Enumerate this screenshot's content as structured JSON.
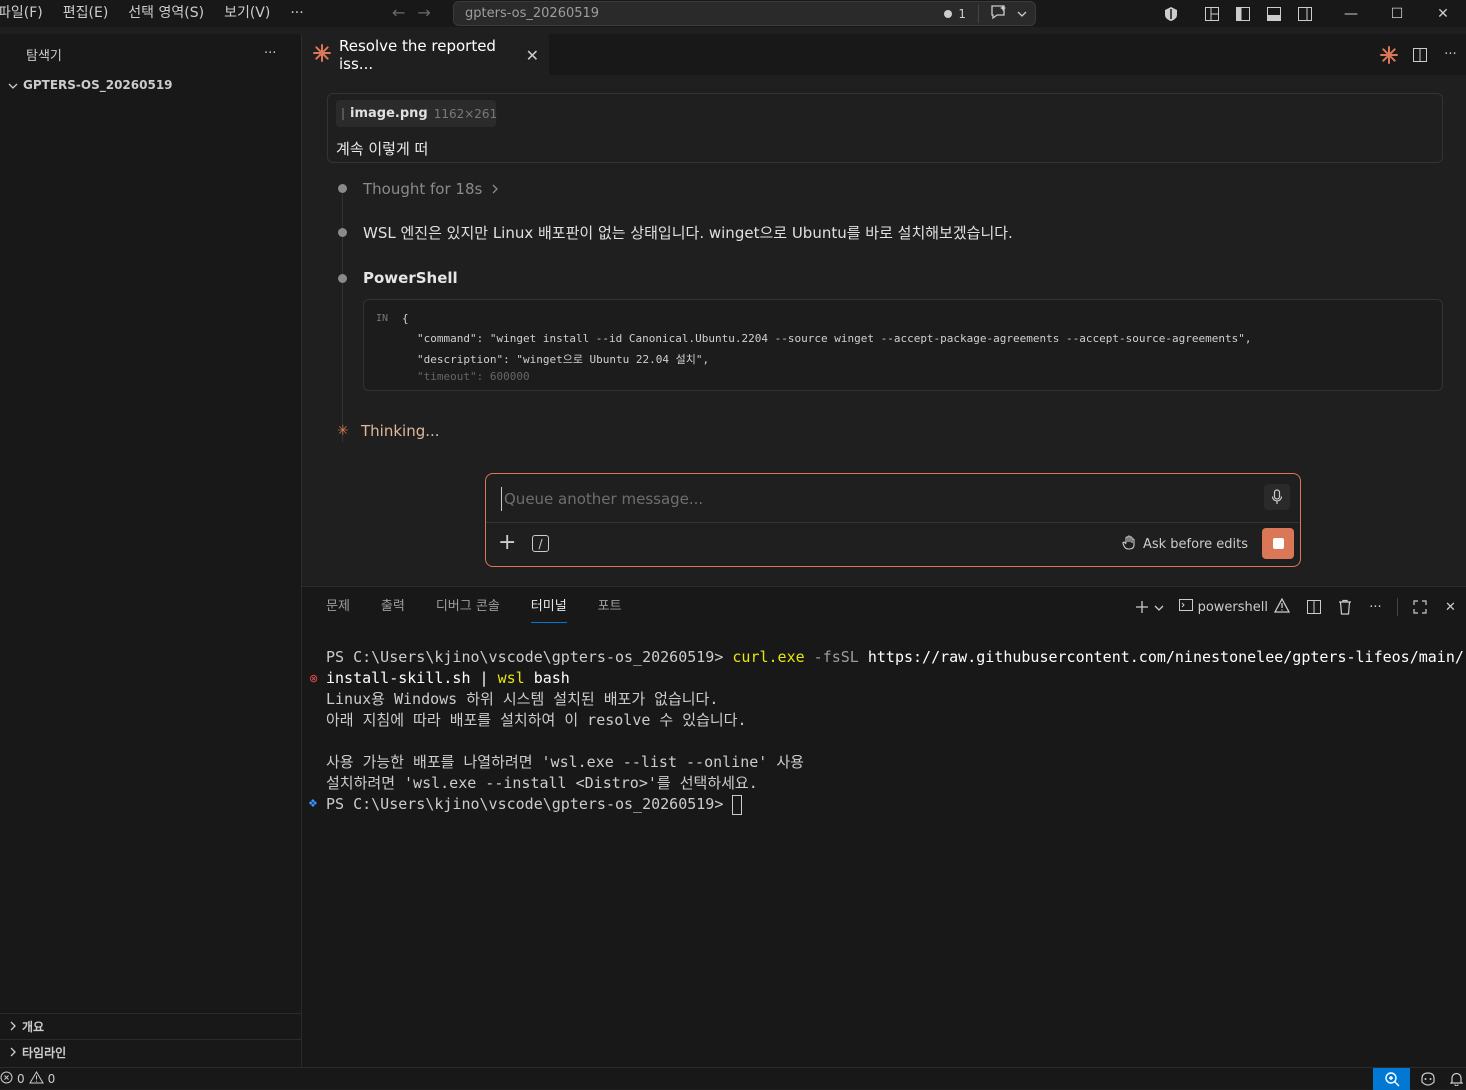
{
  "menu": [
    "파일(F)",
    "편집(E)",
    "선택 영역(S)",
    "보기(V)"
  ],
  "menu_more": "···",
  "command_center": {
    "title": "gpters-os_20260519",
    "badge_count": "1"
  },
  "sidebar": {
    "title": "탐색기",
    "root_folder": "GPTERS-OS_20260519",
    "sections": [
      "개요",
      "타임라인"
    ]
  },
  "tab": {
    "label": "Resolve the reported iss..."
  },
  "chat": {
    "attachment": {
      "name": "image.png",
      "dimensions": "1162×261"
    },
    "user_message": "계속 이렇게 떠",
    "thought": "Thought for 18s",
    "response": "WSL 엔진은 있지만 Linux 배포판이 없는 상태입니다. winget으로 Ubuntu를 바로 설치해보겠습니다.",
    "tool_label": "PowerShell",
    "code": {
      "in_label": "IN",
      "open_brace": "{",
      "line1": "\"command\": \"winget install --id Canonical.Ubuntu.2204 --source winget --accept-package-agreements --accept-source-agreements\",",
      "line2": "\"description\": \"winget으로 Ubuntu 22.04 설치\",",
      "line3": "\"timeout\": 600000"
    },
    "status": "Thinking..."
  },
  "composer": {
    "placeholder": "Queue another message...",
    "mode_label": "Ask before edits"
  },
  "panel": {
    "tabs": [
      "문제",
      "출력",
      "디버그 콘솔",
      "터미널",
      "포트"
    ],
    "active_tab": "터미널",
    "shell_name": "powershell"
  },
  "terminal": {
    "prompt1": "PS C:\\Users\\kjino\\vscode\\gpters-os_20260519> ",
    "cmd_curl": "curl.exe",
    "cmd_flags": " -fsSL ",
    "cmd_url": "https://raw.githubusercontent.com/ninestonelee/gpters-lifeos/main/",
    "cmd_url2": "install-skill.sh",
    "cmd_pipe": " | ",
    "cmd_wsl": "wsl",
    "cmd_bash": " bash",
    "out1": "Linux용 Windows 하위 시스템 설치된 배포가 없습니다.",
    "out2": "아래 지침에 따라 배포를 설치하여 이 resolve 수 있습니다.",
    "out3": "사용 가능한 배포를 나열하려면 'wsl.exe --list --online' 사용",
    "out4": "설치하려면 'wsl.exe --install <Distro>'를 선택하세요.",
    "prompt2": "PS C:\\Users\\kjino\\vscode\\gpters-os_20260519> "
  },
  "status": {
    "errors": "0",
    "warnings": "0"
  },
  "colors": {
    "accent": "#d97757",
    "blue": "#0078d4",
    "terminal_yellow": "#e5e510"
  }
}
